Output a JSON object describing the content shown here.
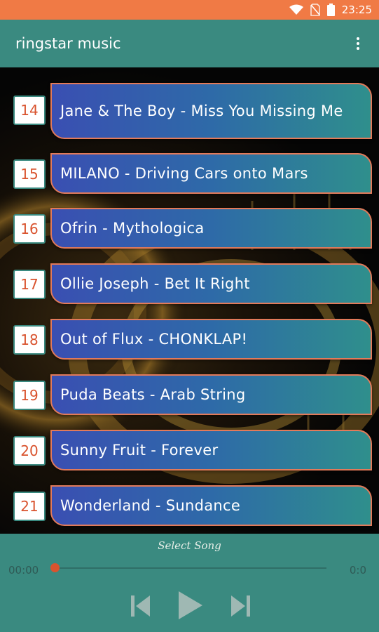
{
  "status_bar": {
    "time": "23:25",
    "icons": [
      "wifi-icon",
      "no-sim-icon",
      "battery-icon"
    ]
  },
  "app_bar": {
    "title": "ringstar music",
    "menu_icon": "more-vert-icon"
  },
  "songs": [
    {
      "number": "14",
      "title": "Jane & The Boy - Miss You Missing Me"
    },
    {
      "number": "15",
      "title": "MILANO - Driving Cars onto Mars"
    },
    {
      "number": "16",
      "title": "Ofrin - Mythologica"
    },
    {
      "number": "17",
      "title": "Ollie Joseph - Bet It Right"
    },
    {
      "number": "18",
      "title": "Out of Flux - CHONKLAP!"
    },
    {
      "number": "19",
      "title": "Puda Beats - Arab String"
    },
    {
      "number": "20",
      "title": "Sunny Fruit - Forever"
    },
    {
      "number": "21",
      "title": "Wonderland - Sundance"
    }
  ],
  "player": {
    "now_playing": "Select Song",
    "elapsed": "00:00",
    "duration": "0:0",
    "progress": 0,
    "controls": [
      "previous-icon",
      "play-icon",
      "next-icon"
    ]
  },
  "colors": {
    "status_bar": "#f07a45",
    "app_bar": "#3a8a80",
    "number_text": "#d9532e",
    "card_border": "#e27a5a"
  }
}
